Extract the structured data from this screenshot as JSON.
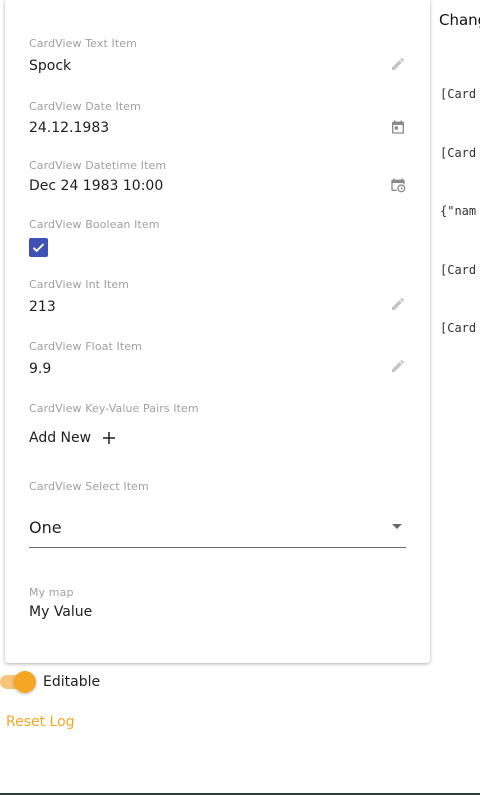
{
  "card": {
    "text_item": {
      "caption": "CardView Text Item",
      "value": "Spock",
      "icon": "pencil-icon"
    },
    "date_item": {
      "caption": "CardView Date Item",
      "value": "24.12.1983",
      "icon": "calendar-icon"
    },
    "datetime_item": {
      "caption": "CardView Datetime Item",
      "value": "Dec 24 1983 10:00",
      "icon": "calendar-clock-icon"
    },
    "boolean_item": {
      "caption": "CardView Boolean Item",
      "checked": true
    },
    "int_item": {
      "caption": "CardView Int Item",
      "value": "213",
      "icon": "pencil-icon"
    },
    "float_item": {
      "caption": "CardView Float Item",
      "value": "9.9",
      "icon": "pencil-icon"
    },
    "kv_item": {
      "caption": "CardView Key-Value Pairs Item",
      "add_label": "Add New",
      "icon": "plus-icon"
    },
    "select_item": {
      "caption": "CardView Select Item",
      "value": "One"
    },
    "map_item": {
      "caption": "My map",
      "value": "My Value"
    }
  },
  "editable_toggle": {
    "label": "Editable",
    "on": true
  },
  "reset_log": {
    "label": "Reset Log"
  },
  "changes": {
    "title": "Chang",
    "log": [
      "[Card",
      "[Card",
      "{\"nam",
      "[Card",
      "[Card"
    ]
  },
  "colors": {
    "accent": "#f5a623",
    "checkbox": "#3f51b5",
    "icon": "#8a8a8a"
  }
}
